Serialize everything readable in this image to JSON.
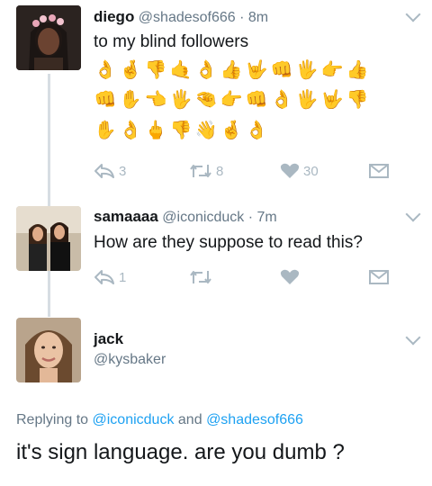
{
  "tweets": [
    {
      "name": "diego",
      "handle": "@shadesof666",
      "time": "8m",
      "text": "to my blind followers",
      "emoji_rows": [
        [
          "👌",
          "🤞",
          "👎",
          "🤙",
          "👌",
          "👍",
          "🤟",
          "👊",
          "🖐",
          "👉",
          "👍"
        ],
        [
          "👊",
          "✋",
          "👈",
          "🖐",
          "🤏",
          "👉",
          "👊",
          "👌",
          "🖐",
          "🤟",
          "👎"
        ],
        [
          "✋",
          "👌",
          "🖕",
          "👎",
          "👋",
          "🤞",
          "👌"
        ]
      ],
      "replies": "3",
      "retweets": "8",
      "likes": "30"
    },
    {
      "name": "samaaaa",
      "handle": "@iconicduck",
      "time": "7m",
      "text": "How are they suppose to read this?",
      "replies": "1"
    },
    {
      "name": "jack",
      "handle": "@kysbaker",
      "replying_prefix": "Replying to",
      "replying_user1": "@iconicduck",
      "replying_and": "and",
      "replying_user2": "@shadesof666",
      "text": "it's sign language. are you dumb ?"
    }
  ]
}
